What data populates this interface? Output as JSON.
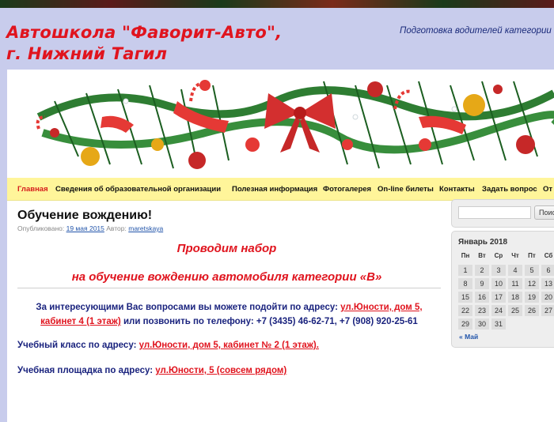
{
  "header": {
    "title": "Автошкола \"Фаворит-Авто\", г. Нижний Тагил",
    "description": "Подготовка водителей категории"
  },
  "nav": {
    "items": [
      {
        "label": "Главная",
        "active": true
      },
      {
        "label": "Сведения об образовательной организации"
      },
      {
        "label": "Полезная информация"
      },
      {
        "label": "Фотогалерея"
      },
      {
        "label": "On-line билеты"
      },
      {
        "label": "Контакты"
      },
      {
        "label": "Задать вопрос"
      },
      {
        "label": "От"
      }
    ]
  },
  "post": {
    "title": "Обучение вождению!",
    "meta_published": "Опубликовано:",
    "meta_date": "19 мая 2015",
    "meta_author_label": "Автор:",
    "meta_author": "maretskaya",
    "heading1": "Проводим набор",
    "heading2": "на обучение вождению автомобиля категории «В»",
    "p1_text_a": "За интересующими Вас вопросами вы можете подойти по адресу:",
    "p1_addr_a": "ул.Юности, дом 5,",
    "p1_addr_b": "кабинет 4 (1 этаж)",
    "p1_text_b": "или позвонить по телефону: +7 (3435) 46-62-71, +7 (908) 920-25-61",
    "p2_text": "Учебный класс по адресу:",
    "p2_addr": "ул.Юности, дом 5, кабинет № 2 (1 этаж).",
    "p3_text": "Учебная площадка по адресу:",
    "p3_addr": "ул.Юности, 5 (совсем рядом)"
  },
  "search": {
    "button": "Поис"
  },
  "calendar": {
    "title": "Январь 2018",
    "days": [
      "Пн",
      "Вт",
      "Ср",
      "Чт",
      "Пт",
      "Сб"
    ],
    "rows": [
      [
        "1",
        "2",
        "3",
        "4",
        "5",
        "6"
      ],
      [
        "8",
        "9",
        "10",
        "11",
        "12",
        "13"
      ],
      [
        "15",
        "16",
        "17",
        "18",
        "19",
        "20"
      ],
      [
        "22",
        "23",
        "24",
        "25",
        "26",
        "27"
      ],
      [
        "29",
        "30",
        "31",
        "",
        "",
        ""
      ]
    ],
    "prev": "« Май"
  }
}
